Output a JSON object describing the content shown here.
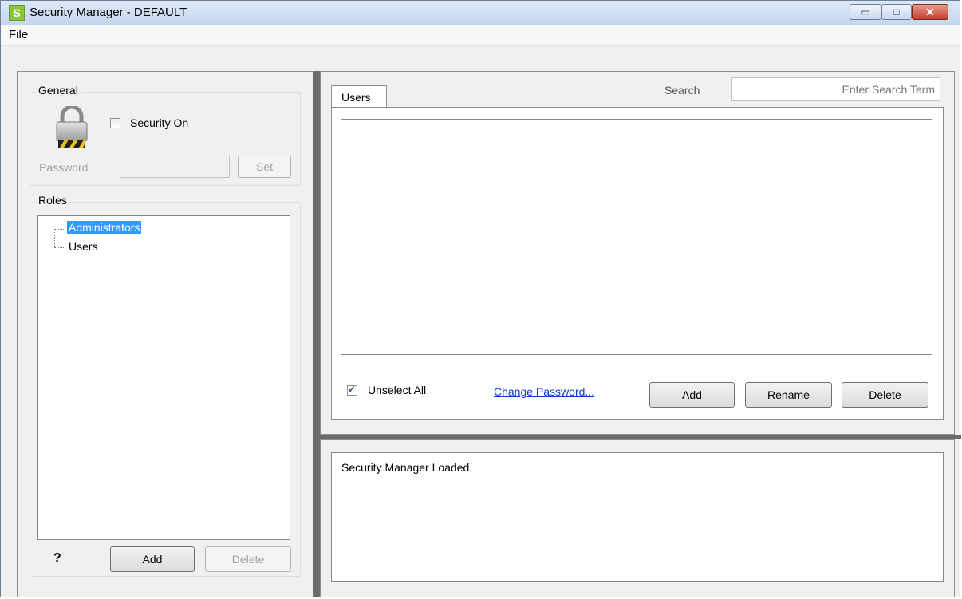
{
  "window": {
    "title": "Security Manager - DEFAULT",
    "app_icon_letter": "S",
    "controls": {
      "minimize": "▭",
      "maximize": "□",
      "close": "✕"
    }
  },
  "menu": {
    "file": "File"
  },
  "general": {
    "legend": "General",
    "security_on_label": "Security On",
    "security_on_checked": false,
    "password_label": "Password",
    "password_value": "",
    "set_button": "Set"
  },
  "roles": {
    "legend": "Roles",
    "items": [
      {
        "label": "Administrators",
        "selected": true
      },
      {
        "label": "Users",
        "selected": false
      }
    ],
    "help": "?",
    "add_button": "Add",
    "delete_button": "Delete"
  },
  "users_panel": {
    "tab_label": "Users",
    "search_label": "Search",
    "search_placeholder": "Enter Search Term",
    "unselect_all_label": "Unselect All",
    "unselect_all_checked": true,
    "change_password_link": "Change Password...",
    "add_button": "Add",
    "rename_button": "Rename",
    "delete_button": "Delete"
  },
  "log": {
    "message": "Security Manager Loaded."
  },
  "colors": {
    "selection": "#3399ff",
    "link": "#0b3cc9",
    "splitter": "#6b6b6b"
  }
}
